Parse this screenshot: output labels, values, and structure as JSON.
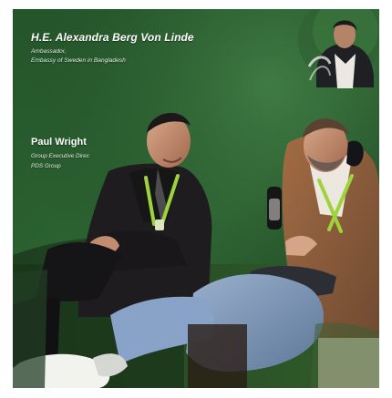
{
  "overlay": {
    "speaker_1_name": "H.E. Alexandra Berg Von Linde",
    "speaker_1_role_line_1": "Ambassador,",
    "speaker_1_role_line_2": "Embassy of Sweden in Bangladesh",
    "speaker_2_name": "Paul Wright",
    "speaker_2_role_line_1": "Group Executive Direc",
    "speaker_2_role_line_2": "PDS Group"
  },
  "colors": {
    "backdrop": "#285b2c",
    "backdrop_dark": "#173219",
    "lanyard": "#9ed33b",
    "jeans": "#7e99bd",
    "blazer": "#8b5b3a",
    "dark_suit": "#1f1c1f",
    "sneaker": "#f2f2ee",
    "cream_banner": "#d9cdb6"
  }
}
